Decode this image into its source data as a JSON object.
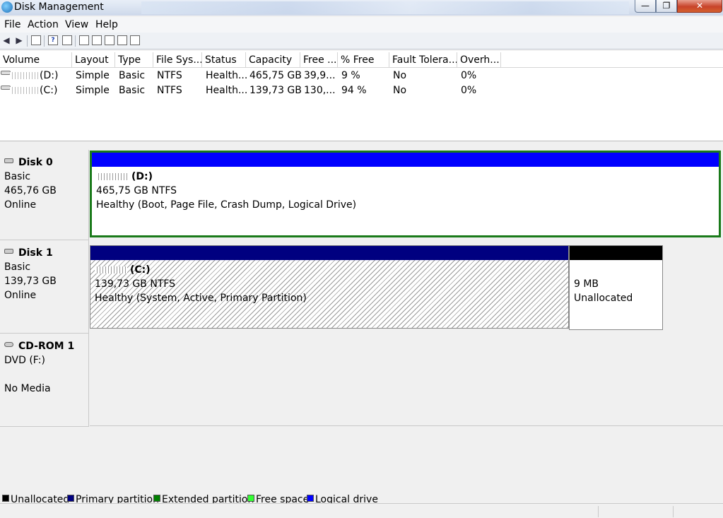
{
  "window": {
    "title": "Disk Management"
  },
  "titlebar": {
    "min_glyph": "—",
    "max_glyph": "❐",
    "close_glyph": "✕"
  },
  "menu": [
    "File",
    "Action",
    "View",
    "Help"
  ],
  "toolbar": {
    "icons": [
      "back-arrow-icon",
      "forward-arrow-icon",
      "show-hide-console-tree-icon",
      "help-icon",
      "properties-icon",
      "refresh-icon",
      "rescan-disks-icon",
      "open-icon",
      "search-icon",
      "settings-icon"
    ],
    "help_glyph": "?"
  },
  "volumes": {
    "columns": [
      "Volume",
      "Layout",
      "Type",
      "File Sys...",
      "Status",
      "Capacity",
      "Free ...",
      "% Free",
      "Fault Tolera...",
      "Overh..."
    ],
    "rows": [
      {
        "volume": "(D:)",
        "layout": "Simple",
        "type": "Basic",
        "fs": "NTFS",
        "status": "Health...",
        "capacity": "465,75 GB",
        "free": "39,9...",
        "pct_free": "9 %",
        "fault": "No",
        "overhead": "0%"
      },
      {
        "volume": "(C:)",
        "layout": "Simple",
        "type": "Basic",
        "fs": "NTFS",
        "status": "Health...",
        "capacity": "139,73 GB",
        "free": "130,...",
        "pct_free": "94 %",
        "fault": "No",
        "overhead": "0%"
      }
    ]
  },
  "disks": [
    {
      "name": "Disk 0",
      "type": "Basic",
      "size": "465,76 GB",
      "state": "Online",
      "partitions": [
        {
          "name": "(D:)",
          "size_fs": "465,75 GB NTFS",
          "status": "Healthy (Boot, Page File, Crash Dump, Logical Drive)"
        }
      ]
    },
    {
      "name": "Disk 1",
      "type": "Basic",
      "size": "139,73 GB",
      "state": "Online",
      "partitions": [
        {
          "name": "(C:)",
          "size_fs": "139,73 GB NTFS",
          "status": "Healthy (System, Active, Primary Partition)"
        },
        {
          "size": "9 MB",
          "status": "Unallocated"
        }
      ]
    },
    {
      "name": "CD-ROM 1",
      "drive": "DVD (F:)",
      "media": "No Media"
    }
  ],
  "legend": [
    {
      "label": "Unallocated",
      "color": "#000000"
    },
    {
      "label": "Primary partition",
      "color": "#000080"
    },
    {
      "label": "Extended partition",
      "color": "#008000"
    },
    {
      "label": "Free space",
      "color": "#33ff33"
    },
    {
      "label": "Logical drive",
      "color": "#0000ff"
    }
  ],
  "colors": {
    "logical_drive": "#0000ff",
    "primary_partition": "#000080",
    "unallocated": "#000000",
    "selection_border": "#1a7a1a"
  }
}
